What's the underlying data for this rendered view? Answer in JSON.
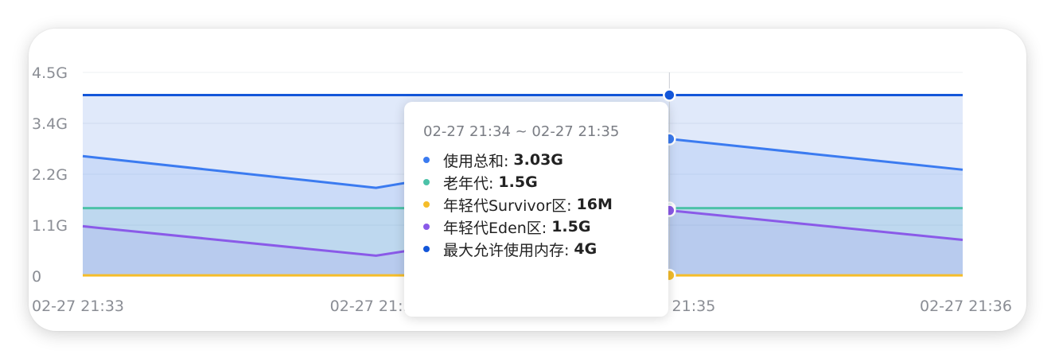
{
  "chart_data": {
    "type": "area",
    "x": [
      "02-27 21:33",
      "02-27 21:34",
      "02-27 21:35",
      "02-27 21:36"
    ],
    "y_ticks": [
      "0",
      "1.1G",
      "2.2G",
      "3.4G",
      "4.5G"
    ],
    "ylim": [
      0,
      4.5
    ],
    "grid": true,
    "series": [
      {
        "name": "使用总和",
        "color": "#3b7bf0",
        "values": [
          2.65,
          1.95,
          3.03,
          2.35
        ]
      },
      {
        "name": "老年代",
        "color": "#4cc2a8",
        "values": [
          1.5,
          1.5,
          1.5,
          1.5
        ]
      },
      {
        "name": "年轻代Survivor区",
        "color": "#f5bd2a",
        "values": [
          0.016,
          0.016,
          0.016,
          0.016
        ]
      },
      {
        "name": "年轻代Eden区",
        "color": "#8a5ae8",
        "values": [
          1.1,
          0.45,
          1.45,
          0.8
        ]
      },
      {
        "name": "最大允许使用内存",
        "color": "#1356d9",
        "values": [
          4.0,
          4.0,
          4.0,
          4.0
        ]
      }
    ],
    "hover_index": 2
  },
  "tooltip": {
    "title": "02-27 21:34 ~ 02-27 21:35",
    "rows": [
      {
        "label": "使用总和:",
        "value": "3.03G",
        "color": "#3b7bf0"
      },
      {
        "label": "老年代:",
        "value": "1.5G",
        "color": "#4cc2a8"
      },
      {
        "label": "年轻代Survivor区:",
        "value": "16M",
        "color": "#f5bd2a"
      },
      {
        "label": "年轻代Eden区:",
        "value": "1.5G",
        "color": "#8a5ae8"
      },
      {
        "label": "最大允许使用内存:",
        "value": "4G",
        "color": "#1356d9"
      }
    ]
  }
}
